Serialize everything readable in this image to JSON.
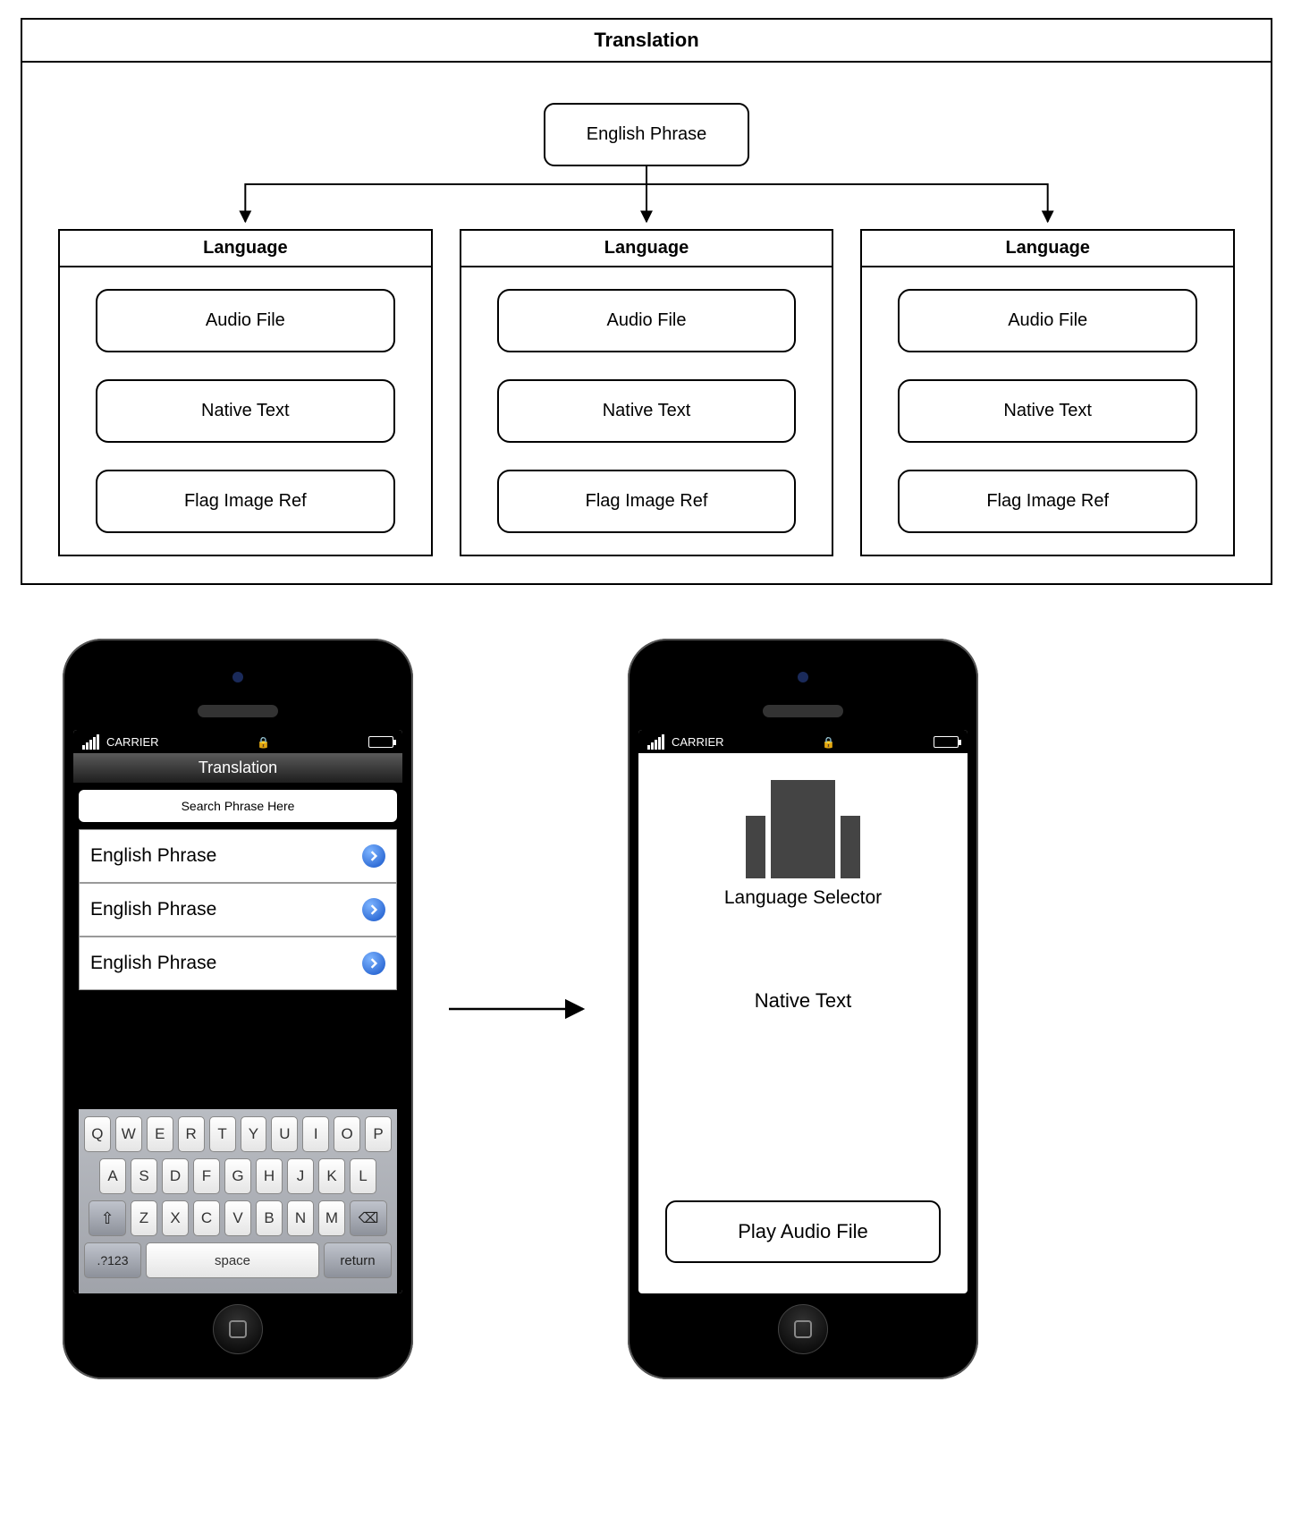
{
  "diagram": {
    "title": "Translation",
    "root": "English Phrase",
    "columns": [
      {
        "header": "Language",
        "items": [
          "Audio File",
          "Native Text",
          "Flag Image Ref"
        ]
      },
      {
        "header": "Language",
        "items": [
          "Audio File",
          "Native Text",
          "Flag Image Ref"
        ]
      },
      {
        "header": "Language",
        "items": [
          "Audio File",
          "Native Text",
          "Flag Image Ref"
        ]
      }
    ]
  },
  "phone1": {
    "carrier": "CARRIER",
    "navTitle": "Translation",
    "searchPlaceholder": "Search Phrase Here",
    "rows": [
      "English Phrase",
      "English Phrase",
      "English Phrase"
    ],
    "keyboard": {
      "row1": [
        "Q",
        "W",
        "E",
        "R",
        "T",
        "Y",
        "U",
        "I",
        "O",
        "P"
      ],
      "row2": [
        "A",
        "S",
        "D",
        "F",
        "G",
        "H",
        "J",
        "K",
        "L"
      ],
      "row3": [
        "Z",
        "X",
        "C",
        "V",
        "B",
        "N",
        "M"
      ],
      "numKey": ".?123",
      "spaceKey": "space",
      "returnKey": "return"
    }
  },
  "phone2": {
    "carrier": "CARRIER",
    "selectorLabel": "Language Selector",
    "nativeText": "Native Text",
    "playLabel": "Play Audio File"
  }
}
